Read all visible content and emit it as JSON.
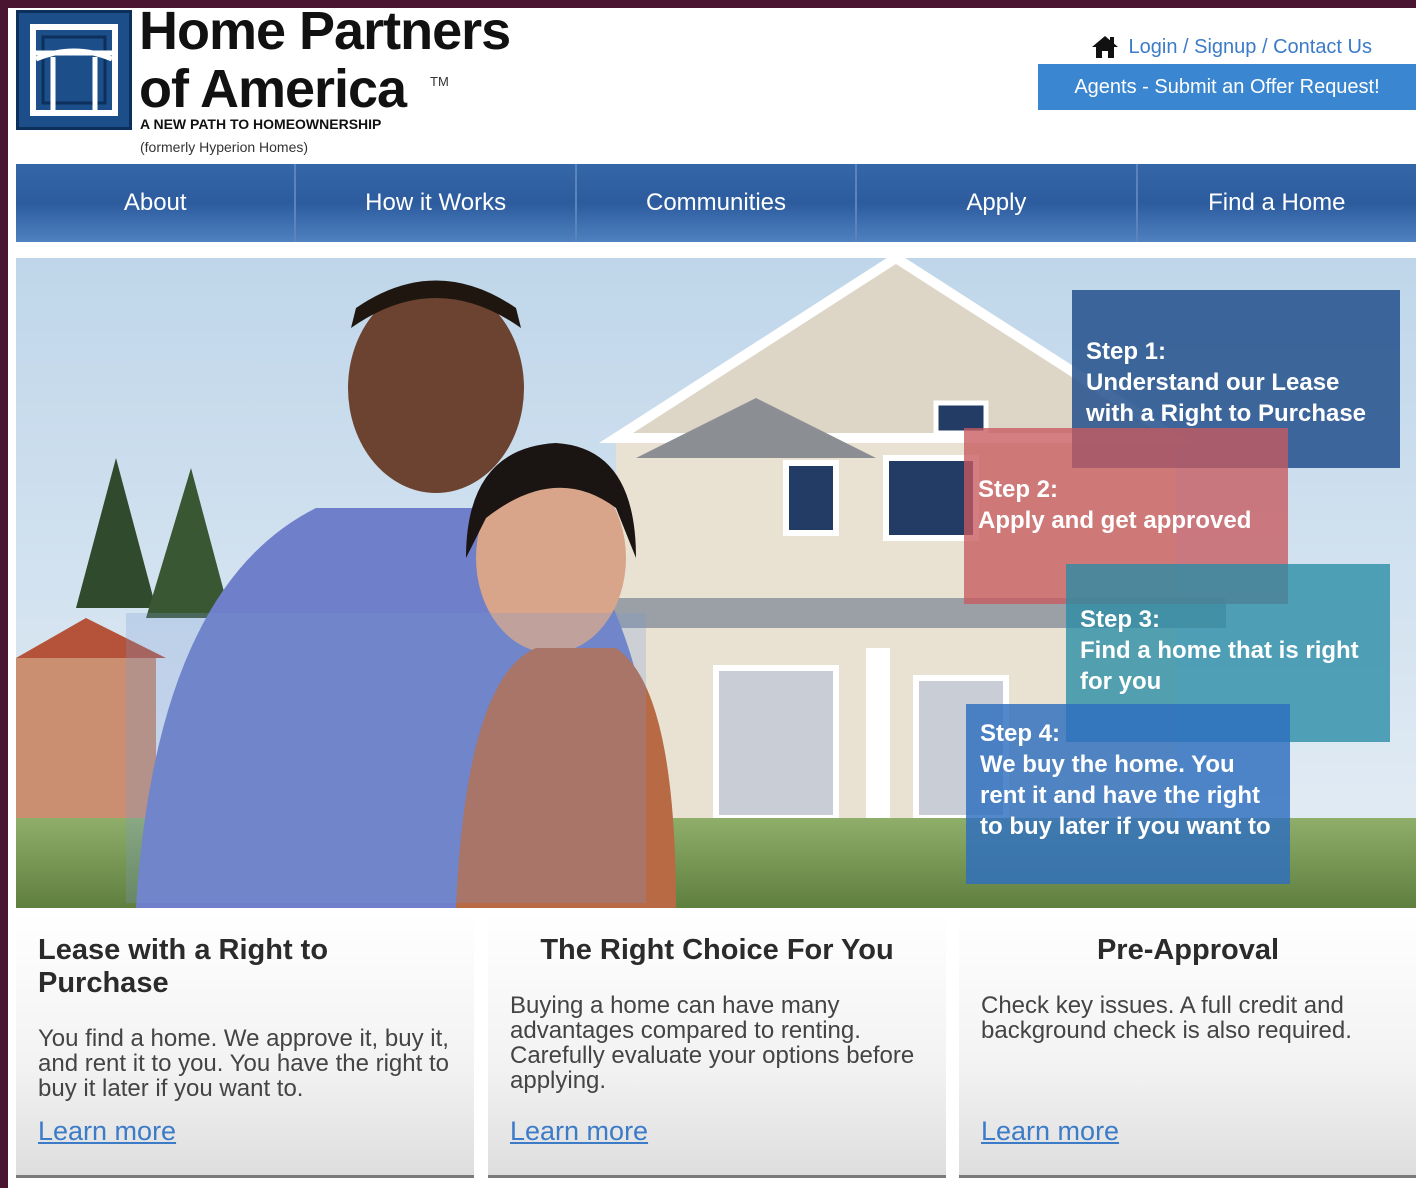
{
  "header": {
    "brand_line1": "Home Partners",
    "brand_line2": "of America",
    "trademark": "TM",
    "tagline": "A NEW PATH TO HOMEOWNERSHIP",
    "formerly": "(formerly Hyperion Homes)",
    "top_links": "Login / Signup / Contact Us",
    "home_icon": "home-icon",
    "agents_button": "Agents - Submit an Offer Request!"
  },
  "nav": {
    "items": [
      {
        "label": "About"
      },
      {
        "label": "How it Works"
      },
      {
        "label": "Communities"
      },
      {
        "label": "Apply"
      },
      {
        "label": "Find a Home"
      }
    ]
  },
  "hero": {
    "steps": [
      {
        "title": "Step 1:",
        "text": "Understand our Lease with a Right to Purchase"
      },
      {
        "title": "Step 2:",
        "text": "Apply and get approved"
      },
      {
        "title": "Step 3:",
        "text": "Find a home that is right for you"
      },
      {
        "title": "Step 4:",
        "text": "We buy the home. You rent it and have the right to buy later if you want to"
      }
    ]
  },
  "columns": [
    {
      "title": "Lease with a Right to Purchase",
      "text": "You find a home. We approve it, buy it, and rent it to you. You have the right to buy it later if you want to.",
      "link": "Learn more"
    },
    {
      "title": "The Right Choice For You",
      "text": "Buying a home can have many advantages compared to renting. Carefully evaluate your options before applying.",
      "link": "Learn more"
    },
    {
      "title": "Pre-Approval",
      "text": "Check key issues. A full credit and background check is also required.",
      "link": "Learn more"
    }
  ],
  "colors": {
    "nav_blue": "#2c5c9e",
    "link_blue": "#3b7bc8",
    "agents_button": "#3a86d0",
    "step1": "#23508c",
    "step2": "#c85a5f",
    "step3": "#288ca5",
    "step4": "#2d6ebe"
  }
}
